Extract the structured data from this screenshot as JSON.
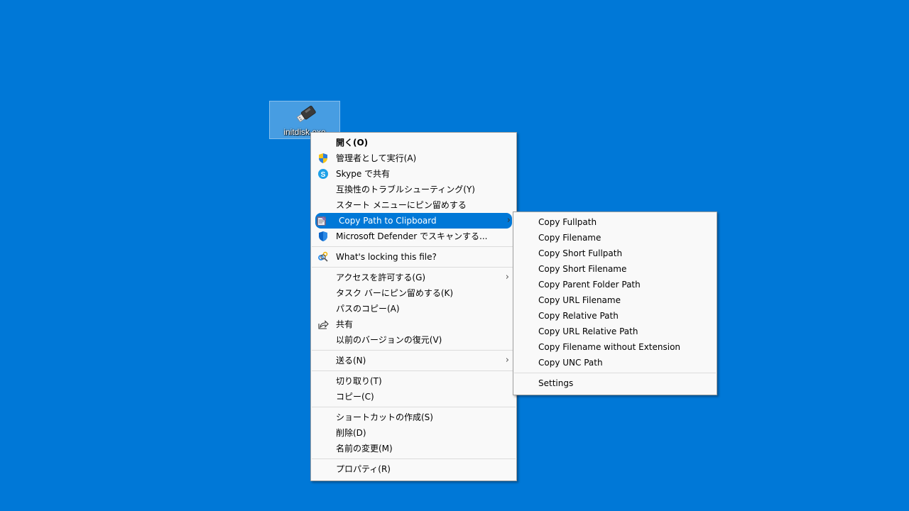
{
  "desktop": {
    "background_color": "#0078d7",
    "selected_file": {
      "label": "initdisk.exe",
      "icon": "usb-drive-icon"
    }
  },
  "context_menu": {
    "groups": [
      [
        {
          "label": "開く(O)",
          "bold": true
        },
        {
          "label": "管理者として実行(A)",
          "icon": "uac-shield-icon"
        },
        {
          "label": "Skype で共有",
          "icon": "skype-icon"
        },
        {
          "label": "互換性のトラブルシューティング(Y)"
        },
        {
          "label": "スタート メニューにピン留めする"
        },
        {
          "label": "Copy Path to Clipboard",
          "icon": "copy-path-icon",
          "submenu": true,
          "highlighted": true
        },
        {
          "label": "Microsoft Defender でスキャンする...",
          "icon": "defender-shield-icon"
        }
      ],
      [
        {
          "label": "What's locking this file?",
          "icon": "lock-search-icon"
        }
      ],
      [
        {
          "label": "アクセスを許可する(G)",
          "submenu": true
        },
        {
          "label": "タスク バーにピン留めする(K)"
        },
        {
          "label": "パスのコピー(A)"
        },
        {
          "label": "共有",
          "icon": "share-icon"
        },
        {
          "label": "以前のバージョンの復元(V)"
        }
      ],
      [
        {
          "label": "送る(N)",
          "submenu": true
        }
      ],
      [
        {
          "label": "切り取り(T)"
        },
        {
          "label": "コピー(C)"
        }
      ],
      [
        {
          "label": "ショートカットの作成(S)"
        },
        {
          "label": "削除(D)"
        },
        {
          "label": "名前の変更(M)"
        }
      ],
      [
        {
          "label": "プロパティ(R)"
        }
      ]
    ],
    "chevron": "›"
  },
  "submenu": {
    "parent": "Copy Path to Clipboard",
    "items": [
      "Copy Fullpath",
      "Copy Filename",
      "Copy Short Fullpath",
      "Copy Short Filename",
      "Copy Parent Folder Path",
      "Copy URL Filename",
      "Copy Relative Path",
      "Copy URL Relative Path",
      "Copy Filename without Extension",
      "Copy UNC Path"
    ],
    "footer": "Settings"
  }
}
